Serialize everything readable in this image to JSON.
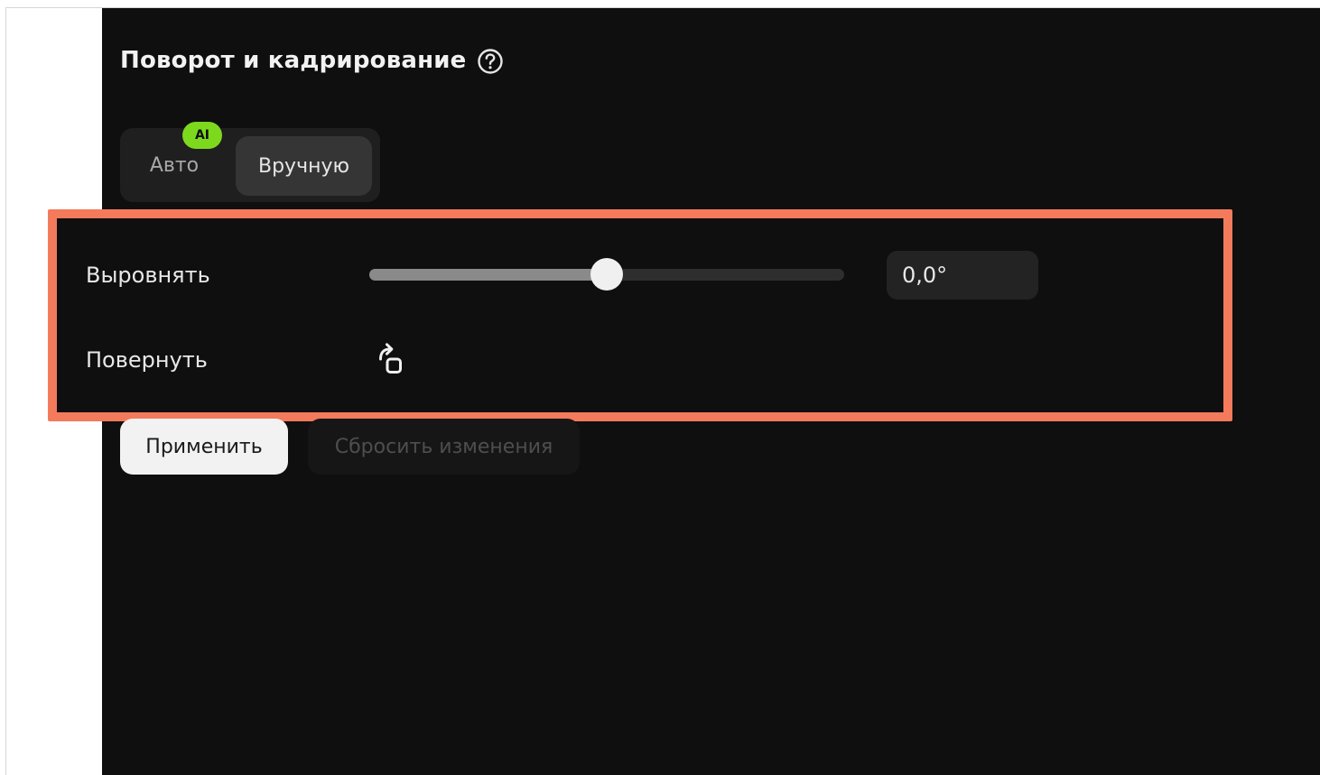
{
  "panel": {
    "title": "Поворот и кадрирование",
    "help_icon": "question-circle-icon"
  },
  "mode_tabs": {
    "auto_label": "Авто",
    "ai_badge": "AI",
    "manual_label": "Вручную",
    "selected": "Вручную"
  },
  "straighten": {
    "label": "Выровнять",
    "slider_fraction": 0.5,
    "value": "0,0°"
  },
  "rotate": {
    "label": "Повернуть",
    "icon": "rotate-clockwise-icon"
  },
  "actions": {
    "apply_label": "Применить",
    "reset_label": "Сбросить изменения"
  },
  "colors": {
    "background": "#0f0f0f",
    "ai_badge": "#7dd91e",
    "highlight": "#f47a5c"
  }
}
